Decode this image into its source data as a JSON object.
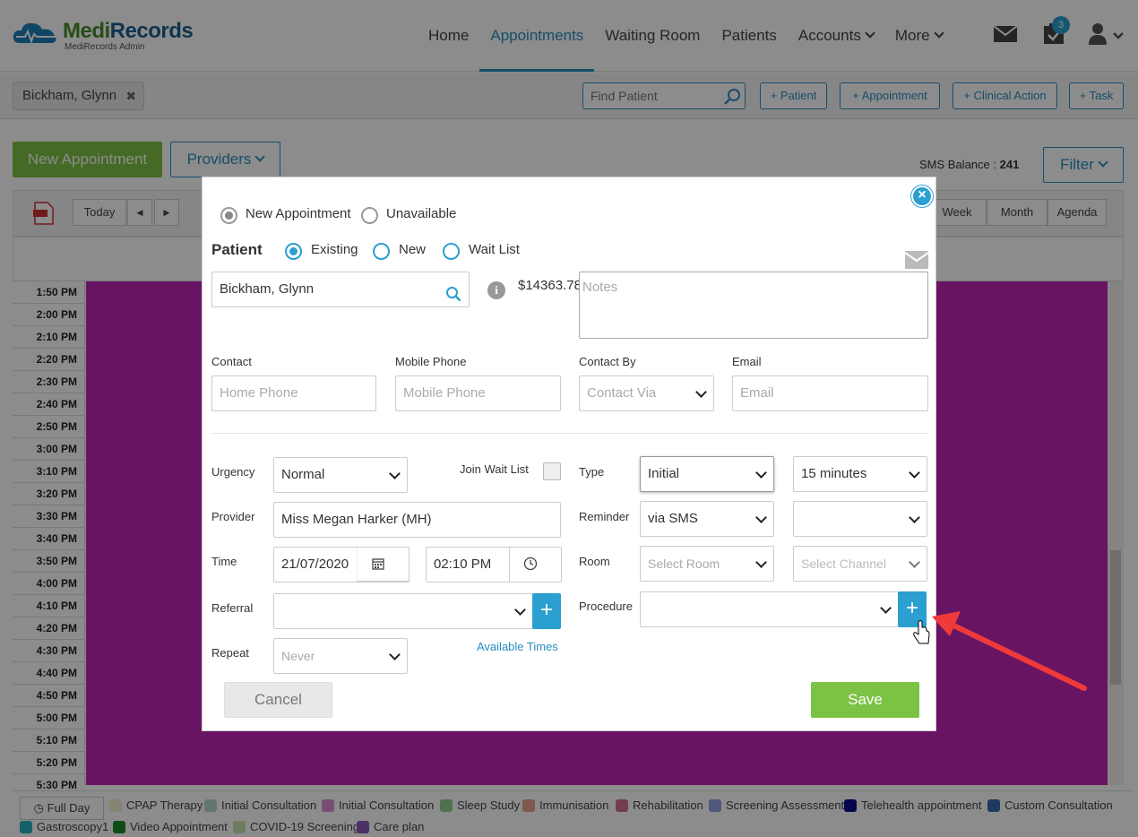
{
  "app": {
    "logo_name_part1": "Medi",
    "logo_name_part2": "Records",
    "logo_sub": "MediRecords Admin",
    "nav": {
      "home": "Home",
      "appointments": "Appointments",
      "waiting_room": "Waiting Room",
      "patients": "Patients",
      "accounts": "Accounts",
      "more": "More"
    },
    "task_badge": "3"
  },
  "subbar": {
    "patient_chip": "Bickham, Glynn",
    "find_patient_placeholder": "Find Patient",
    "quick_patient": "+ Patient",
    "quick_appointment": "+ Appointment",
    "quick_clinical_action": "+ Clinical Action",
    "quick_task": "+ Task"
  },
  "page": {
    "new_appointment": "New Appointment",
    "providers": "Providers",
    "sms_balance_label": "SMS Balance : ",
    "sms_balance_value": "241",
    "filter": "Filter"
  },
  "toolbar": {
    "today": "Today",
    "prev": "◀",
    "next": "▶",
    "week": "Week",
    "month": "Month",
    "agenda": "Agenda"
  },
  "calendar": {
    "times": [
      "1:50 PM",
      "2:00 PM",
      "2:10 PM",
      "2:20 PM",
      "2:30 PM",
      "2:40 PM",
      "2:50 PM",
      "3:00 PM",
      "3:10 PM",
      "3:20 PM",
      "3:30 PM",
      "3:40 PM",
      "3:50 PM",
      "4:00 PM",
      "4:10 PM",
      "4:20 PM",
      "4:30 PM",
      "4:40 PM",
      "4:50 PM",
      "5:00 PM",
      "5:10 PM",
      "5:20 PM",
      "5:30 PM"
    ],
    "fill_color": "#c026b4"
  },
  "legend": {
    "full_day": "Full Day",
    "items": [
      {
        "label": "CPAP Therapy",
        "color": "#f5f0d0"
      },
      {
        "label": "Initial Consultation",
        "color": "#b9d8d0"
      },
      {
        "label": "Initial Consultation",
        "color": "#d98fd0"
      },
      {
        "label": "Sleep Study",
        "color": "#8fd08f"
      },
      {
        "label": "Immunisation",
        "color": "#e8a090"
      },
      {
        "label": "Rehabilitation",
        "color": "#d0708a"
      },
      {
        "label": "Screening Assessment",
        "color": "#8fa0e0"
      },
      {
        "label": "Telehealth appointment",
        "color": "#0a0a8a"
      },
      {
        "label": "Custom Consultation",
        "color": "#3a6ab0"
      },
      {
        "label": "Gastroscopy1",
        "color": "#2ab0c0"
      },
      {
        "label": "Video Appointment",
        "color": "#1a8a2a"
      },
      {
        "label": "COVID-19 Screening",
        "color": "#c8e0b0"
      },
      {
        "label": "Care plan",
        "color": "#8a5ac0"
      }
    ]
  },
  "modal": {
    "mode_new": "New Appointment",
    "mode_unavailable": "Unavailable",
    "patient_heading": "Patient",
    "patient_existing": "Existing",
    "patient_new": "New",
    "patient_waitlist": "Wait List",
    "patient_value": "Bickham, Glynn",
    "balance": "$14363.78",
    "notes_placeholder": "Notes",
    "contact_label": "Contact",
    "contact_placeholder": "Home Phone",
    "mobile_label": "Mobile Phone",
    "mobile_placeholder": "Mobile Phone",
    "contact_by_label": "Contact By",
    "contact_by_placeholder": "Contact Via",
    "email_label": "Email",
    "email_placeholder": "Email",
    "urgency_label": "Urgency",
    "urgency_value": "Normal",
    "join_waitlist_label": "Join Wait List",
    "type_label": "Type",
    "type_value": "Initial",
    "duration_value": "15 minutes",
    "provider_label": "Provider",
    "provider_value": "Miss Megan Harker (MH)",
    "reminder_label": "Reminder",
    "reminder_value": "via SMS",
    "time_label": "Time",
    "date_value": "21/07/2020",
    "time_value": "02:10 PM",
    "room_label": "Room",
    "room_placeholder": "Select Room",
    "channel_placeholder": "Select Channel",
    "referral_label": "Referral",
    "procedure_label": "Procedure",
    "repeat_label": "Repeat",
    "repeat_value": "Never",
    "available_times": "Available Times",
    "cancel": "Cancel",
    "save": "Save",
    "plus": "+"
  }
}
